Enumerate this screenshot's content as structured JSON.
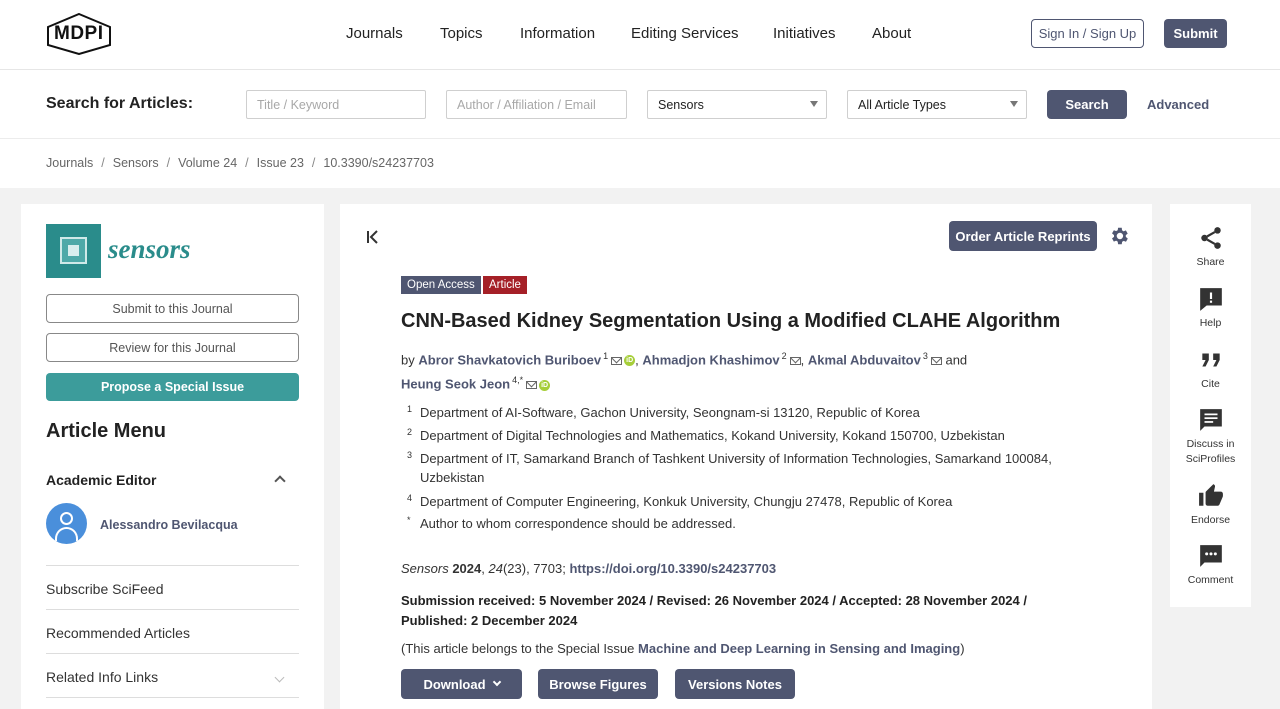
{
  "header": {
    "logo": "MDPI",
    "nav": [
      "Journals",
      "Topics",
      "Information",
      "Editing Services",
      "Initiatives",
      "About"
    ],
    "sign_in": "Sign In / Sign Up",
    "submit": "Submit"
  },
  "search": {
    "label": "Search for Articles:",
    "title_placeholder": "Title / Keyword",
    "author_placeholder": "Author / Affiliation / Email",
    "journal_value": "Sensors",
    "type_value": "All Article Types",
    "button": "Search",
    "advanced": "Advanced"
  },
  "breadcrumb": [
    "Journals",
    "Sensors",
    "Volume 24",
    "Issue 23",
    "10.3390/s24237703"
  ],
  "sidebar": {
    "journal_name": "sensors",
    "submit_btn": "Submit to this Journal",
    "review_btn": "Review for this Journal",
    "propose_btn": "Propose a Special Issue",
    "menu_title": "Article Menu",
    "editor_heading": "Academic Editor",
    "editor_name": "Alessandro Bevilacqua",
    "links": [
      "Subscribe SciFeed",
      "Recommended Articles",
      "Related Info Links"
    ]
  },
  "article": {
    "reprints": "Order Article Reprints",
    "badge_oa": "Open Access",
    "badge_type": "Article",
    "title": "CNN-Based Kidney Segmentation Using a Modified CLAHE Algorithm",
    "by": "by",
    "authors": [
      {
        "name": "Abror Shavkatovich Buriboev",
        "sup": "1"
      },
      {
        "name": "Ahmadjon Khashimov",
        "sup": "2"
      },
      {
        "name": "Akmal Abduvaitov",
        "sup": "3"
      },
      {
        "name": "Heung Seok Jeon",
        "sup": "4,*"
      }
    ],
    "and": "and",
    "affiliations": [
      {
        "num": "1",
        "text": "Department of AI-Software, Gachon University, Seongnam-si 13120, Republic of Korea"
      },
      {
        "num": "2",
        "text": "Department of Digital Technologies and Mathematics, Kokand University, Kokand 150700, Uzbekistan"
      },
      {
        "num": "3",
        "text": "Department of IT, Samarkand Branch of Tashkent University of Information Technologies, Samarkand 100084, Uzbekistan"
      },
      {
        "num": "4",
        "text": "Department of Computer Engineering, Konkuk University, Chungju 27478, Republic of Korea"
      },
      {
        "num": "*",
        "text": "Author to whom correspondence should be addressed."
      }
    ],
    "citation": {
      "journal": "Sensors",
      "year": "2024",
      "volume": "24",
      "rest": "(23), 7703;",
      "doi": "https://doi.org/10.3390/s24237703"
    },
    "dates": "Submission received: 5 November 2024 / Revised: 26 November 2024 / Accepted: 28 November 2024 / Published: 2 December 2024",
    "special_prefix": "(This article belongs to the Special Issue",
    "special_issue": "Machine and Deep Learning in Sensing and Imaging",
    "special_suffix": ")",
    "download": "Download",
    "browse": "Browse Figures",
    "versions": "Versions Notes"
  },
  "tools": [
    {
      "icon": "share-icon",
      "label": "Share"
    },
    {
      "icon": "help-icon",
      "label": "Help"
    },
    {
      "icon": "cite-icon",
      "label": "Cite"
    },
    {
      "icon": "discuss-icon",
      "label": "Discuss in SciProfiles"
    },
    {
      "icon": "endorse-icon",
      "label": "Endorse"
    },
    {
      "icon": "comment-icon",
      "label": "Comment"
    }
  ],
  "colors": {
    "primary": "#4f5671",
    "teal": "#2a8c8b",
    "article_badge": "#a52027",
    "orcid": "#a6ce39"
  }
}
